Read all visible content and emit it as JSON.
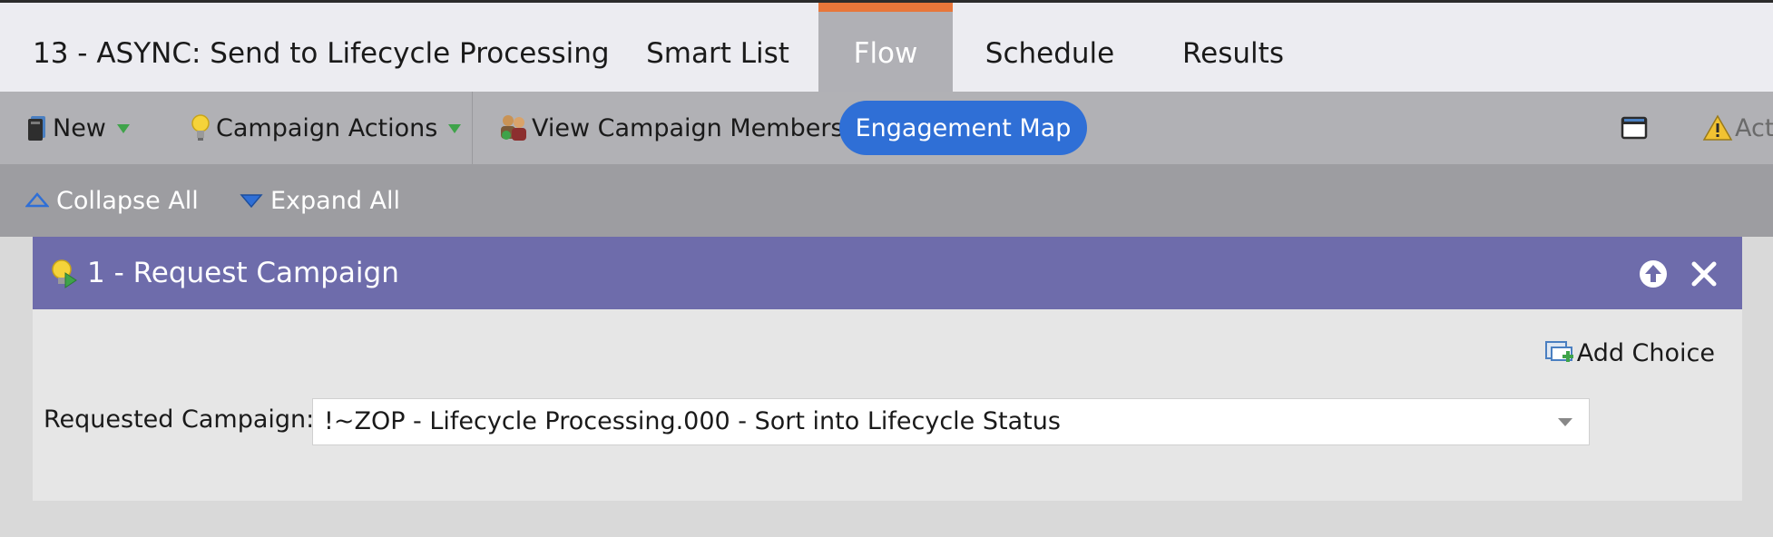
{
  "campaign_title": "13 - ASYNC: Send to Lifecycle Processing",
  "tabs": [
    {
      "label": "Smart List",
      "active": false
    },
    {
      "label": "Flow",
      "active": true
    },
    {
      "label": "Schedule",
      "active": false
    },
    {
      "label": "Results",
      "active": false
    }
  ],
  "toolbar": {
    "new_label": "New",
    "campaign_actions_label": "Campaign Actions",
    "view_members_label": "View Campaign Members",
    "engagement_map_label": "Engagement Map",
    "activity_label": "Act"
  },
  "flow_toolbar": {
    "collapse_all_label": "Collapse All",
    "expand_all_label": "Expand All"
  },
  "flow_step": {
    "title": "1 - Request Campaign",
    "add_choice_label": "Add Choice",
    "field_label": "Requested Campaign:",
    "field_value": "!~ZOP - Lifecycle Processing.000 - Sort into Lifecycle Status"
  },
  "colors": {
    "active_tab_accent": "#e8763a",
    "engagement_map_button": "#2f6fd6",
    "step_header": "#6e6cab"
  }
}
